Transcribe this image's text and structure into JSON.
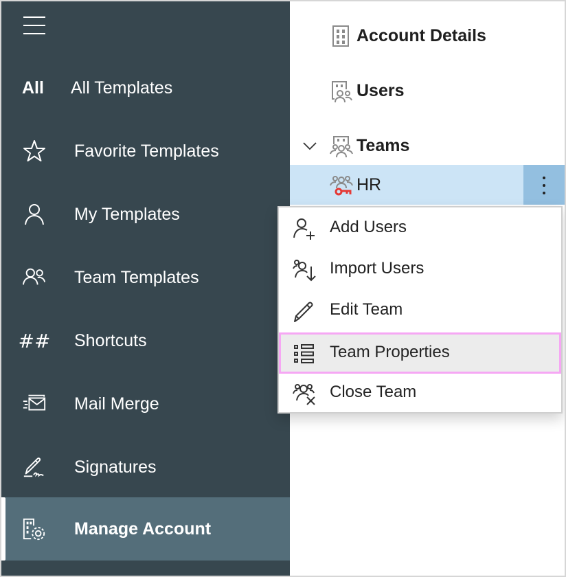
{
  "sidebar": {
    "menu_icon": "hamburger-icon",
    "items": [
      {
        "icon": "All",
        "label": "All Templates"
      },
      {
        "icon": "star-icon",
        "label": "Favorite Templates"
      },
      {
        "icon": "person-icon",
        "label": "My Templates"
      },
      {
        "icon": "people-icon",
        "label": "Team Templates"
      },
      {
        "icon": "hash-icon",
        "label": "Shortcuts"
      },
      {
        "icon": "mail-merge-icon",
        "label": "Mail Merge"
      },
      {
        "icon": "signature-icon",
        "label": "Signatures"
      },
      {
        "icon": "building-gear-icon",
        "label": "Manage Account",
        "active": true
      }
    ]
  },
  "tree": {
    "items": [
      {
        "icon": "building-icon",
        "label": "Account Details"
      },
      {
        "icon": "building-people-icon",
        "label": "Users"
      },
      {
        "icon": "building-team-icon",
        "label": "Teams",
        "expanded": true
      },
      {
        "icon": "team-key-icon",
        "label": "HR",
        "selected": true
      }
    ]
  },
  "context_menu": {
    "items": [
      {
        "icon": "add-user-icon",
        "label": "Add Users"
      },
      {
        "icon": "import-users-icon",
        "label": "Import Users"
      },
      {
        "icon": "pencil-icon",
        "label": "Edit Team"
      },
      {
        "icon": "list-icon",
        "label": "Team Properties",
        "highlighted": true
      },
      {
        "icon": "close-team-icon",
        "label": "Close Team"
      }
    ]
  },
  "colors": {
    "sidebar_bg": "#37474f",
    "sidebar_active_bg": "#546e7a",
    "selected_row_bg": "#cce4f6",
    "more_button_bg": "#93bfe0",
    "highlight_outline": "#f6a7f4",
    "key_icon": "#e53935"
  }
}
